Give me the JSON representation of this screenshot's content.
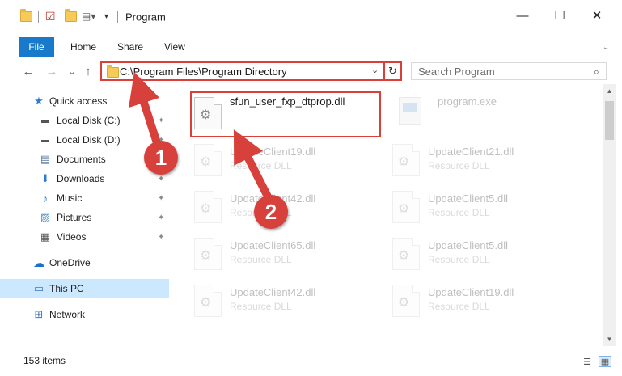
{
  "window": {
    "title": "Program",
    "minimize_glyph": "—",
    "maximize_glyph": "☐",
    "close_glyph": "✕"
  },
  "ribbon": {
    "tabs": [
      "File",
      "Home",
      "Share",
      "View"
    ]
  },
  "nav": {
    "back_glyph": "←",
    "forward_glyph": "→",
    "recent_glyph": "⌄",
    "up_glyph": "↑"
  },
  "address": {
    "path": "C:\\Program Files\\Program Directory",
    "dropdown_glyph": "⌄",
    "refresh_glyph": "↻"
  },
  "search": {
    "placeholder": "Search Program",
    "icon_glyph": "⌕"
  },
  "sidebar": {
    "items": [
      {
        "label": "Quick access",
        "icon": "star-icon",
        "glyph": "★",
        "color": "#2c7bd1",
        "pinned": false
      },
      {
        "label": "Local Disk (C:)",
        "icon": "drive-icon",
        "glyph": "▬",
        "color": "#555555",
        "pinned": true
      },
      {
        "label": "Local Disk (D:)",
        "icon": "drive-icon",
        "glyph": "▬",
        "color": "#555555",
        "pinned": true
      },
      {
        "label": "Documents",
        "icon": "documents-icon",
        "glyph": "▤",
        "color": "#5b7a9c",
        "pinned": true
      },
      {
        "label": "Downloads",
        "icon": "download-icon",
        "glyph": "⬇",
        "color": "#2c7bd1",
        "pinned": true
      },
      {
        "label": "Music",
        "icon": "music-icon",
        "glyph": "♪",
        "color": "#2c7bd1",
        "pinned": true
      },
      {
        "label": "Pictures",
        "icon": "pictures-icon",
        "glyph": "▨",
        "color": "#4d8bbf",
        "pinned": true
      },
      {
        "label": "Videos",
        "icon": "video-icon",
        "glyph": "▦",
        "color": "#555555",
        "pinned": true
      },
      {
        "label": "OneDrive",
        "icon": "cloud-icon",
        "glyph": "☁",
        "color": "#1a73c9",
        "pinned": false
      },
      {
        "label": "This PC",
        "icon": "computer-icon",
        "glyph": "▭",
        "color": "#3a78b8",
        "pinned": false
      },
      {
        "label": "Network",
        "icon": "network-icon",
        "glyph": "⊞",
        "color": "#3a78b8",
        "pinned": false
      }
    ],
    "pin_glyph": "📌"
  },
  "files": [
    {
      "name": "sfun_user_fxp_dtprop.dll",
      "type": "",
      "highlighted": true
    },
    {
      "name": "program.exe",
      "type": "",
      "exe": true
    },
    {
      "name": "UpdateClient19.dll",
      "type": "Resource DLL"
    },
    {
      "name": "UpdateClient21.dll",
      "type": "Resource DLL"
    },
    {
      "name": "UpdateClient42.dll",
      "type": "Resource DLL"
    },
    {
      "name": "UpdateClient5.dll",
      "type": "Resource DLL"
    },
    {
      "name": "UpdateClient65.dll",
      "type": "Resource DLL"
    },
    {
      "name": "UpdateClient5.dll",
      "type": "Resource DLL"
    },
    {
      "name": "UpdateClient42.dll",
      "type": "Resource DLL"
    },
    {
      "name": "UpdateClient19.dll",
      "type": "Resource DLL"
    }
  ],
  "status": {
    "item_count": "153 items"
  },
  "annotations": {
    "step1": "1",
    "step2": "2",
    "color": "#d8403b"
  }
}
